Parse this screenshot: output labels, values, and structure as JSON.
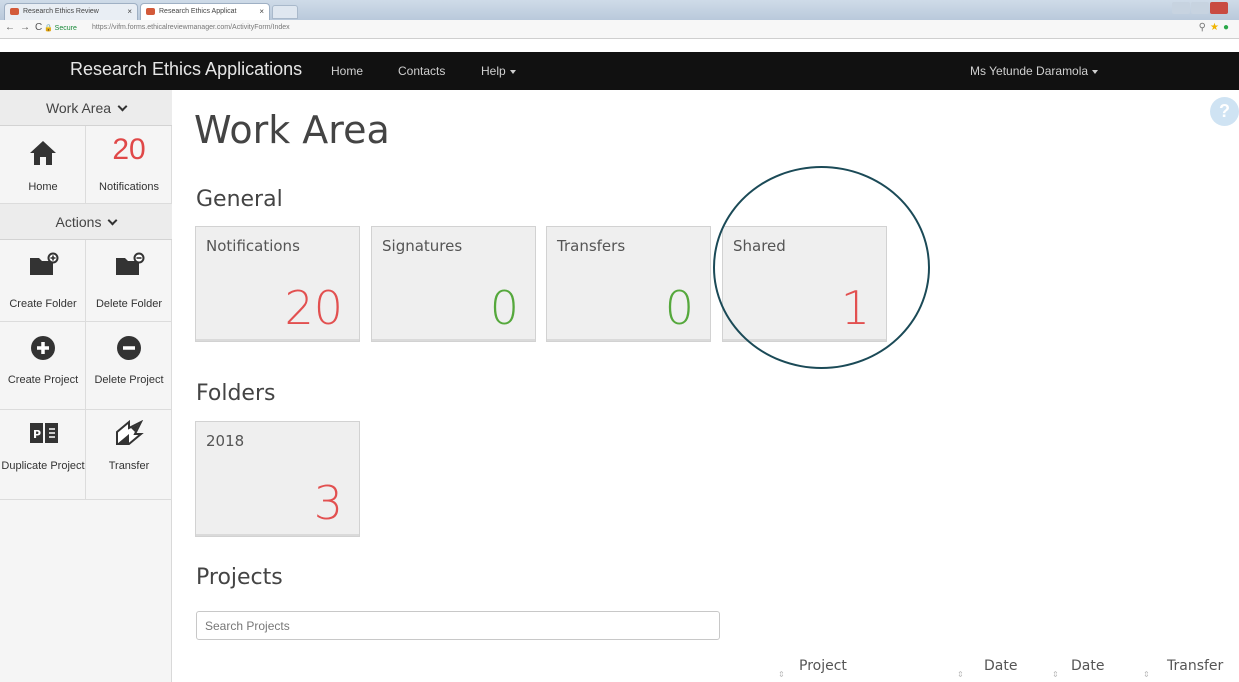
{
  "browser": {
    "tabs": [
      {
        "label": "Research Ethics Review"
      },
      {
        "label": "Research Ethics Applicat"
      }
    ],
    "secure_label": "Secure",
    "url": "https://vifm.forms.ethicalreviewmanager.com/ActivityForm/Index"
  },
  "navbar": {
    "brand": "Research Ethics Applications",
    "home": "Home",
    "contacts": "Contacts",
    "help": "Help",
    "user": "Ms Yetunde Daramola"
  },
  "sidebar": {
    "work_area_header": "Work Area",
    "home_label": "Home",
    "notifications_count": "20",
    "notifications_label": "Notifications",
    "actions_header": "Actions",
    "create_folder": "Create Folder",
    "delete_folder": "Delete Folder",
    "create_project": "Create Project",
    "delete_project": "Delete Project",
    "duplicate_project": "Duplicate Project",
    "transfer": "Transfer"
  },
  "main": {
    "title": "Work Area",
    "general_heading": "General",
    "general_tiles": [
      {
        "label": "Notifications",
        "value": "20",
        "color": "#e25050"
      },
      {
        "label": "Signatures",
        "value": "0",
        "color": "#55a83c"
      },
      {
        "label": "Transfers",
        "value": "0",
        "color": "#55a83c"
      },
      {
        "label": "Shared",
        "value": "1",
        "color": "#e25050"
      }
    ],
    "folders_heading": "Folders",
    "folders": [
      {
        "label": "2018",
        "value": "3",
        "color": "#e25050"
      }
    ],
    "projects_heading": "Projects",
    "search_placeholder": "Search Projects",
    "columns": [
      "Project",
      "Date",
      "Date",
      "Transfer"
    ]
  }
}
